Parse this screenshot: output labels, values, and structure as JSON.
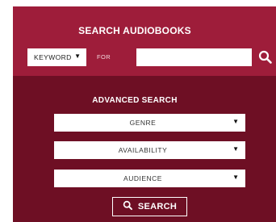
{
  "colors": {
    "header_band": "#9e1d3a",
    "panel": "#6e0f24",
    "field_bg": "#ffffff",
    "text_light": "#ffffff"
  },
  "search": {
    "title": "SEARCH AUDIOBOOKS",
    "field_select": {
      "value": "KEYWORD",
      "icon": "caret-down-icon"
    },
    "for_label": "FOR",
    "input_value": "",
    "submit_icon": "search-icon"
  },
  "advanced": {
    "title": "ADVANCED SEARCH",
    "filters": [
      {
        "label": "GENRE",
        "icon": "caret-down-icon"
      },
      {
        "label": "AVAILABILITY",
        "icon": "caret-down-icon"
      },
      {
        "label": "AUDIENCE",
        "icon": "caret-down-icon"
      }
    ],
    "search_button": {
      "label": "SEARCH",
      "icon": "search-icon"
    }
  }
}
